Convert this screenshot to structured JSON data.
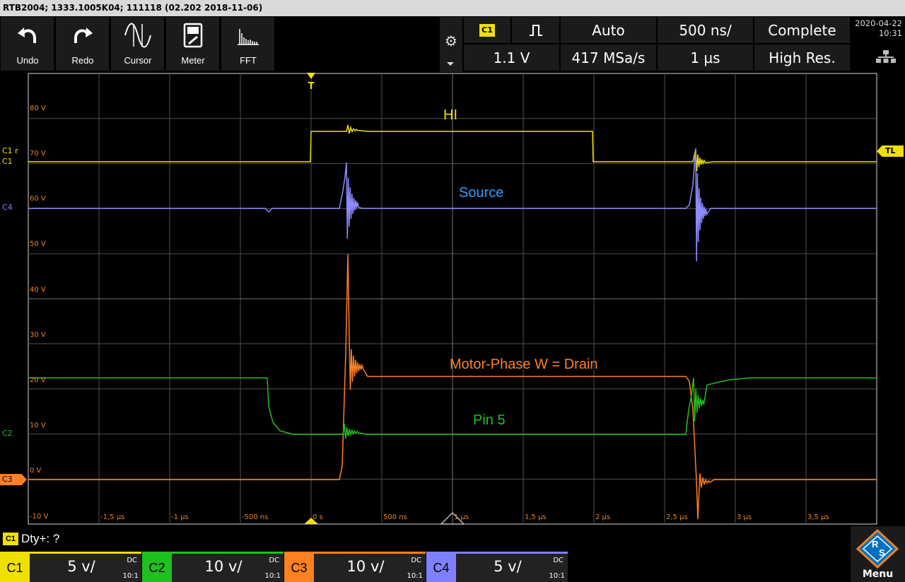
{
  "title": "RTB2004; 1333.1005K04; 111118 (02.202 2018-11-06)",
  "toolbar": {
    "undo": "Undo",
    "redo": "Redo",
    "cursor": "Cursor",
    "meter": "Meter",
    "fft": "FFT"
  },
  "trigger": {
    "source_badge": "C1",
    "mode": "Auto",
    "timebase": "500 ns/",
    "acquisition": "Complete",
    "level": "1.1 V",
    "sample_rate": "417 MSa/s",
    "horizontal_position": "1 µs",
    "resolution": "High Res."
  },
  "datetime": {
    "date": "2020-04-22",
    "time": "10:31"
  },
  "y_labels": [
    "80 V",
    "70 V",
    "60 V",
    "50 V",
    "40 V",
    "30 V",
    "20 V",
    "10 V",
    "0 V",
    "-10 V"
  ],
  "x_labels": [
    "-1,5 µs",
    "-1 µs",
    "-500 ns",
    "0 s",
    "500 ns",
    "1 µs",
    "1,5 µs",
    "2 µs",
    "2,5 µs",
    "3 µs",
    "3,5 µs"
  ],
  "annotations": {
    "hi": "HI",
    "source": "Source",
    "motor_phase": "Motor-Phase W  = Drain",
    "pin5": "Pin 5"
  },
  "markers": {
    "trigger_top": "T",
    "c1r": "C1 r",
    "c1": "C1",
    "c4": "C4",
    "c2": "C2",
    "c3": "C3",
    "tl": "TL"
  },
  "measurement": {
    "badge": "C1",
    "text": "Dty+: ?"
  },
  "channels": [
    {
      "name": "C1",
      "scale": "5 v/",
      "coupling": "DC",
      "probe": "10:1",
      "color": "#f0e000"
    },
    {
      "name": "C2",
      "scale": "10 v/",
      "coupling": "DC",
      "probe": "10:1",
      "color": "#20c020"
    },
    {
      "name": "C3",
      "scale": "10 v/",
      "coupling": "DC",
      "probe": "10:1",
      "color": "#ff8020"
    },
    {
      "name": "C4",
      "scale": "5 v/",
      "coupling": "DC",
      "probe": "10:1",
      "color": "#8080ff"
    }
  ],
  "menu_label": "Menu",
  "colors": {
    "yellow": "#f0e000",
    "blue": "#8c8cff",
    "orange": "#ff8020",
    "green": "#20c020",
    "grid": "#505050"
  }
}
